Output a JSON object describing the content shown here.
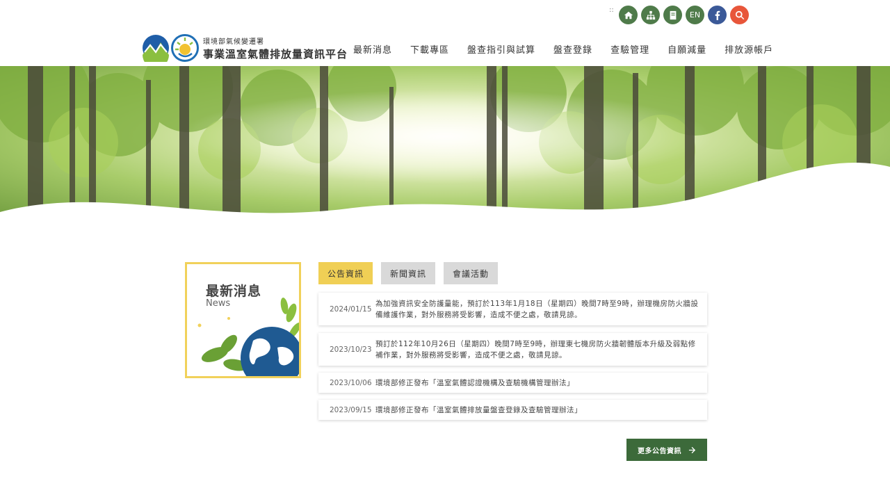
{
  "header": {
    "accesskey": "::",
    "icons": {
      "home": "home-icon",
      "sitemap": "sitemap-icon",
      "book": "book-icon",
      "lang": "EN",
      "facebook": "facebook-icon",
      "search": "search-icon"
    },
    "logo": {
      "subtitle": "環境部氣候變遷署",
      "title": "事業溫室氣體排放量資訊平台"
    },
    "nav": [
      "最新消息",
      "下載專區",
      "盤查指引與試算",
      "盤查登錄",
      "查驗管理",
      "自願減量",
      "排放源帳戶"
    ]
  },
  "news_box": {
    "title": "最新消息",
    "subtitle": "News"
  },
  "tabs": [
    {
      "label": "公告資訊",
      "active": true
    },
    {
      "label": "新聞資訊",
      "active": false
    },
    {
      "label": "會議活動",
      "active": false
    }
  ],
  "announcements": [
    {
      "date": "2024/01/15",
      "text": "為加強資訊安全防護量能，預訂於113年1月18日（星期四）晚間7時至9時，辦理機房防火牆設備維護作業，對外服務將受影響，造成不便之處，敬請見諒。"
    },
    {
      "date": "2023/10/23",
      "text": "預訂於112年10月26日（星期四）晚間7時至9時，辦理東七機房防火牆韌體版本升級及弱點修補作業，對外服務將受影響，造成不便之處，敬請見諒。"
    },
    {
      "date": "2023/10/06",
      "text": "環境部修正發布「溫室氣體認證機構及查驗機構管理辦法」"
    },
    {
      "date": "2023/09/15",
      "text": "環境部修正發布「溫室氣體排放量盤查登錄及查驗管理辦法」"
    }
  ],
  "more_button": {
    "label": "更多公告資訊"
  },
  "colors": {
    "accent_yellow": "#f0cf55",
    "brand_green": "#3c6a3a",
    "icon_green": "#4f7b4a",
    "facebook": "#3b5998",
    "search": "#e8563a"
  }
}
